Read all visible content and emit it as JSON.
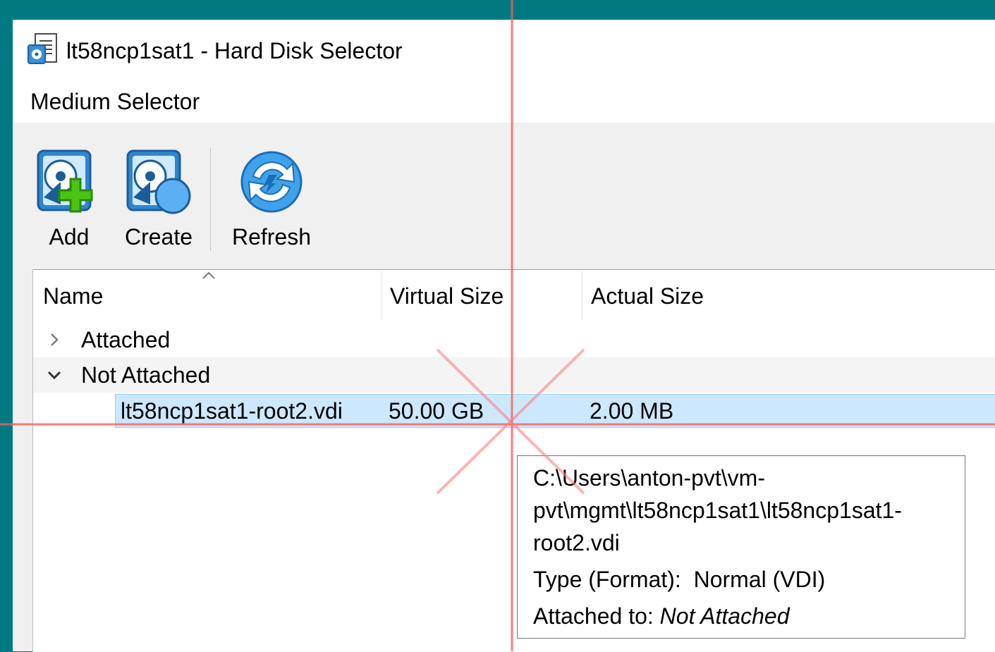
{
  "window": {
    "title": "lt58ncp1sat1 - Hard Disk Selector",
    "icon": "hard-disk-selector-icon"
  },
  "menu": {
    "label": "Medium Selector"
  },
  "toolbar": {
    "add_label": "Add",
    "create_label": "Create",
    "refresh_label": "Refresh"
  },
  "table": {
    "columns": [
      "Name",
      "Virtual Size",
      "Actual Size"
    ],
    "groups": [
      {
        "label": "Attached",
        "expanded": false
      },
      {
        "label": "Not Attached",
        "expanded": true
      }
    ],
    "rows": [
      {
        "name": "lt58ncp1sat1-root2.vdi",
        "virtual_size": "50.00 GB",
        "actual_size": "2.00 MB",
        "selected": true
      }
    ]
  },
  "tooltip": {
    "path_lines": [
      "C:\\Users\\anton-pvt\\vm-",
      "pvt\\mgmt\\lt58ncp1sat1\\lt58ncp1sat1-",
      "root2.vdi"
    ],
    "type_label": "Type (Format):",
    "type_value": "Normal (VDI)",
    "attached_label": "Attached to:",
    "attached_value": "Not Attached"
  },
  "colors": {
    "desktop": "#007a80",
    "selection": "#cce8ff",
    "selection_border": "#99d1ff",
    "crosshair": "#ff5a5a"
  }
}
